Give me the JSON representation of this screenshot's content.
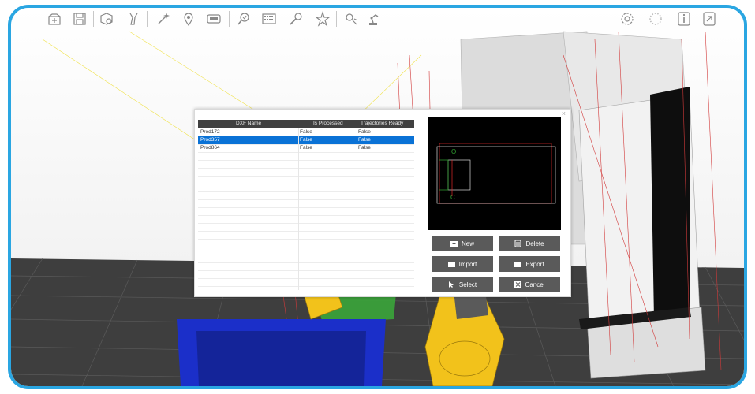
{
  "toolbar": {
    "icons": [
      "new-file-icon",
      "save-icon",
      "import-robot-icon",
      "wrench-icon",
      "magic-wand-icon",
      "location-pin-icon",
      "display-icon",
      "search-check-icon",
      "keyboard-icon",
      "microphone-icon",
      "star-tool-icon",
      "gear-robot-icon",
      "robot-arm-icon",
      "settings-gear-icon",
      "loading-icon",
      "info-icon",
      "fullscreen-icon"
    ]
  },
  "dialog": {
    "close_label": "×",
    "columns": [
      "DXF Name",
      "Is Processed",
      "Trajectories Ready"
    ],
    "rows": [
      {
        "name": "Prod172",
        "processed": "False",
        "ready": "False"
      },
      {
        "name": "Prod357",
        "processed": "False",
        "ready": "False"
      },
      {
        "name": "Prod864",
        "processed": "False",
        "ready": "False"
      }
    ],
    "selected_row": 1,
    "preview_labels": {
      "top": "O",
      "bottom": "C"
    },
    "buttons": {
      "new": "New",
      "delete": "Delete",
      "import": "Import",
      "export": "Export",
      "select": "Select",
      "cancel": "Cancel"
    }
  },
  "colors": {
    "accent_border": "#2aa6e2",
    "selection": "#0a72d6",
    "button_bg": "#5a5a5a",
    "header_bg": "#404040",
    "robot_yellow": "#f2c21b",
    "table_blue": "#1b2fc9",
    "fixture_green": "#3aa53a"
  }
}
